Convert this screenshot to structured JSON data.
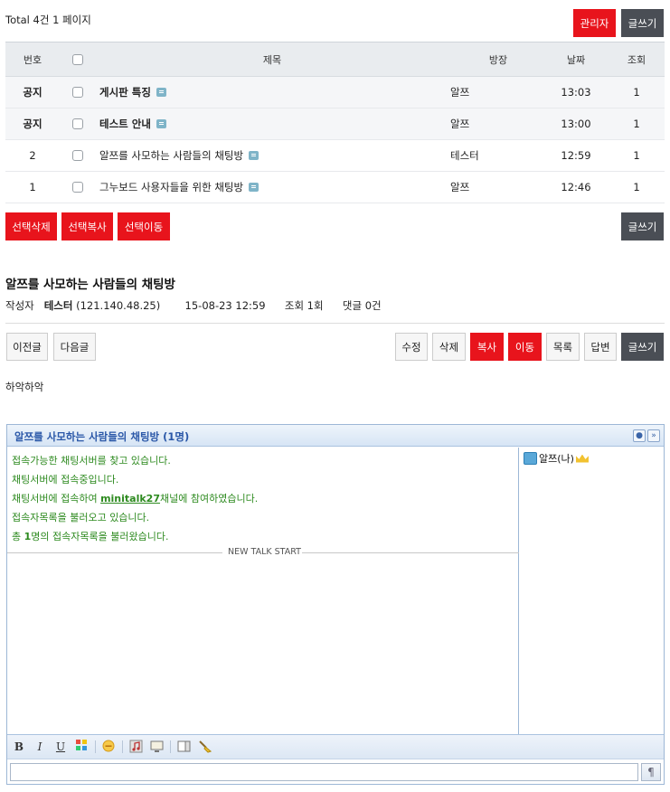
{
  "board": {
    "total_text": "Total 4건 1 페이지",
    "admin_label": "관리자",
    "write_label": "글쓰기",
    "columns": [
      "번호",
      "제목",
      "방장",
      "날짜",
      "조회"
    ],
    "rows": [
      {
        "num": "공지",
        "title": "게시판 특징",
        "name": "알쯔",
        "date": "13:03",
        "views": "1"
      },
      {
        "num": "공지",
        "title": "테스트 안내",
        "name": "알쯔",
        "date": "13:00",
        "views": "1"
      },
      {
        "num": "2",
        "title": "알쯔를 사모하는 사람들의 채팅방",
        "name": "테스터",
        "date": "12:59",
        "views": "1"
      },
      {
        "num": "1",
        "title": "그누보드 사용자들을 위한 채팅방",
        "name": "알쯔",
        "date": "12:46",
        "views": "1"
      }
    ],
    "bulk": {
      "delete": "선택삭제",
      "copy": "선택복사",
      "move": "선택이동"
    }
  },
  "post": {
    "title": "알쯔를 사모하는 사람들의 채팅방",
    "author_label": "작성자",
    "author": "테스터",
    "ip": "(121.140.48.25)",
    "datetime": "15-08-23 12:59",
    "views": "조회 1회",
    "comments": "댓글 0건",
    "body": "하악하악",
    "nav": {
      "prev": "이전글",
      "next": "다음글"
    },
    "actions": {
      "edit": "수정",
      "delete": "삭제",
      "copy": "복사",
      "move": "이동",
      "list": "목록",
      "reply": "답변",
      "write": "글쓰기"
    }
  },
  "chat": {
    "title": "알쯔를 사모하는 사람들의 채팅방 (1명)",
    "log": {
      "l1": "접속가능한 채팅서버를 찾고 있습니다.",
      "l2": "채팅서버에 접속중입니다.",
      "l3_pre": "채팅서버에 접속하여 ",
      "l3_channel": "minitalk27",
      "l3_post": "채널에 참여하였습니다.",
      "l4": "접속자목록을 불러오고 있습니다.",
      "l5_pre": "총 ",
      "l5_count": "1",
      "l5_post": "명의 접속자목록을 불러왔습니다."
    },
    "talk_start": "NEW TALK START",
    "users": [
      "알쯔(나)"
    ],
    "toolbar": {
      "bold": "B",
      "italic": "I",
      "underline": "U"
    },
    "send_glyph": "¶"
  },
  "colors": {
    "red": "#e8141c",
    "dark": "#4a4e55",
    "log_green": "#2d8a1f",
    "chat_blue": "#2b58a8"
  },
  "icons": [
    "checkbox-icon",
    "comment-icon",
    "user-list-icon",
    "expand-icon",
    "user-icon",
    "crown-icon",
    "color-icon",
    "emoticon-icon",
    "music-icon",
    "screen-icon",
    "box-icon",
    "clear-icon"
  ]
}
